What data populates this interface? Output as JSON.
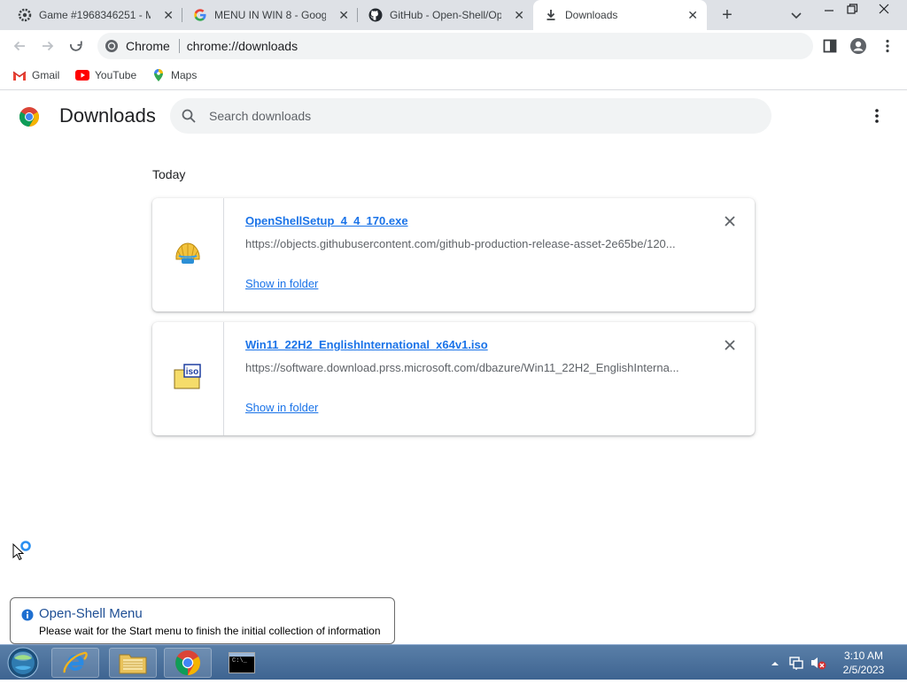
{
  "tabs": [
    {
      "title": "Game #1968346251 - Mi",
      "icon": "gear-logo-icon",
      "active": false
    },
    {
      "title": "MENU IN WIN 8 - Google",
      "icon": "google-icon",
      "active": false
    },
    {
      "title": "GitHub - Open-Shell/Op",
      "icon": "github-icon",
      "active": false
    },
    {
      "title": "Downloads",
      "icon": "download-icon",
      "active": true
    }
  ],
  "omnibox": {
    "label": "Chrome",
    "url": "chrome://downloads"
  },
  "bookmarks": [
    {
      "label": "Gmail",
      "icon": "gmail-icon"
    },
    {
      "label": "YouTube",
      "icon": "youtube-icon"
    },
    {
      "label": "Maps",
      "icon": "maps-icon"
    }
  ],
  "page": {
    "title": "Downloads",
    "search_placeholder": "Search downloads",
    "section": "Today"
  },
  "downloads": [
    {
      "filename": "OpenShellSetup_4_4_170.exe",
      "url": "https://objects.githubusercontent.com/github-production-release-asset-2e65be/120...",
      "action": "Show in folder",
      "icon": "shell-installer-icon"
    },
    {
      "filename": "Win11_22H2_EnglishInternational_x64v1.iso",
      "url": "https://software.download.prss.microsoft.com/dbazure/Win11_22H2_EnglishInterna...",
      "action": "Show in folder",
      "icon": "iso-file-icon"
    }
  ],
  "notification": {
    "title": "Open-Shell Menu",
    "message": "Please wait for the Start menu to finish the initial collection of information"
  },
  "taskbar": {
    "items": [
      "start-orb-icon",
      "internet-explorer-icon",
      "file-explorer-icon",
      "chrome-icon",
      "command-prompt-icon"
    ],
    "cmd_text": "C:\\_",
    "time": "3:10 AM",
    "date": "2/5/2023"
  },
  "colors": {
    "accent": "#1a73e8",
    "tabstrip": "#dee1e6",
    "taskbar": "#3e6491"
  }
}
